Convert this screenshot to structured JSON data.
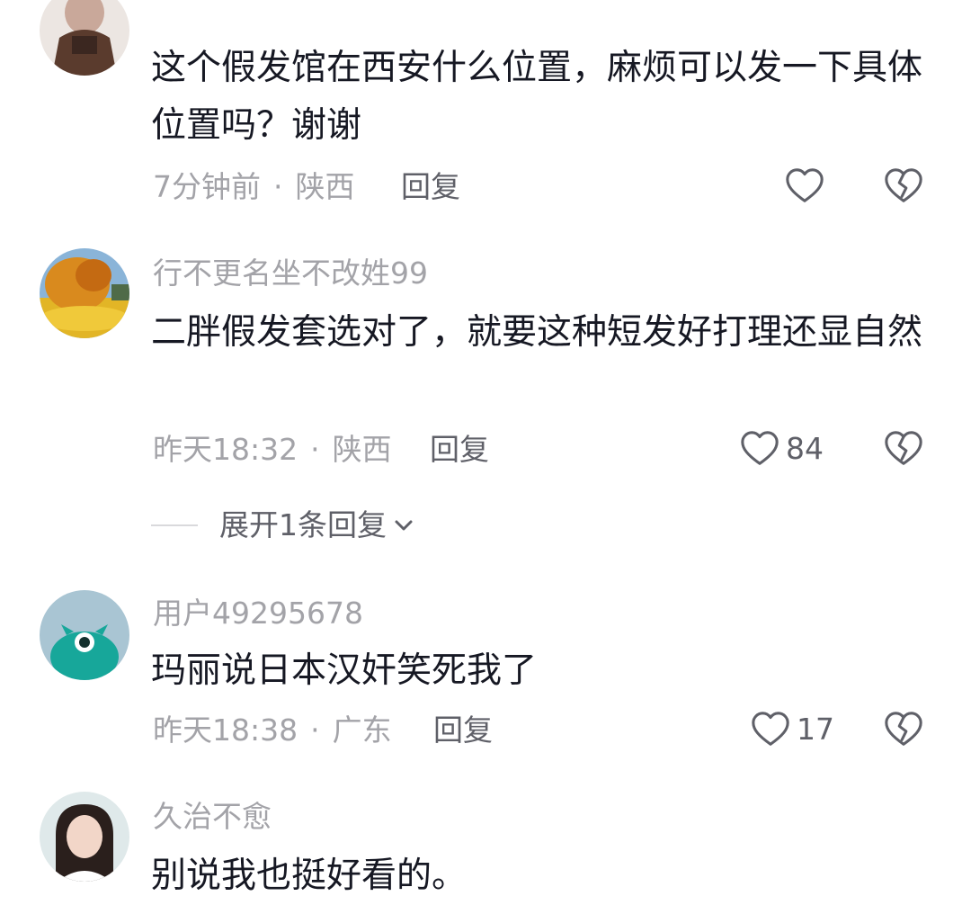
{
  "comments": [
    {
      "username": "",
      "text": "这个假发馆在西安什么位置，麻烦可以发一下具体位置吗？谢谢",
      "time": "7分钟前",
      "location": "陕西",
      "reply_label": "回复",
      "likes": "",
      "avatar_icon": "avatar-woman-dark-top"
    },
    {
      "username": "行不更名坐不改姓99",
      "text": "二胖假发套选对了，就要这种短发好打理还显自然",
      "time": "昨天18:32",
      "location": "陕西",
      "reply_label": "回复",
      "likes": "84",
      "expand_label": "展开1条回复",
      "avatar_icon": "avatar-autumn-tree"
    },
    {
      "username": "用户49295678",
      "text": "玛丽说日本汉奸笑死我了",
      "time": "昨天18:38",
      "location": "广东",
      "reply_label": "回复",
      "likes": "17",
      "avatar_icon": "avatar-teal-monster"
    },
    {
      "username": "久治不愈",
      "text": "别说我也挺好看的。",
      "avatar_icon": "avatar-girl-portrait"
    }
  ],
  "separator_dot": "·",
  "colors": {
    "background": "#ffffff",
    "primary_text": "#161823",
    "secondary_text": "#a3a3a8",
    "action_text": "#5f6068"
  }
}
